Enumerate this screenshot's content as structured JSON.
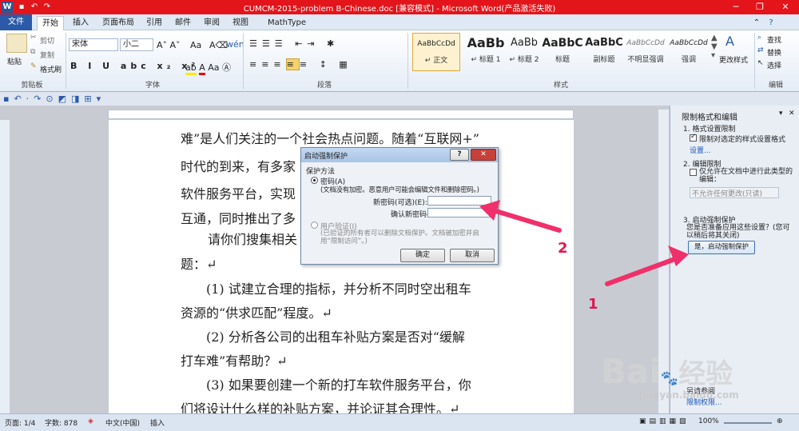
{
  "titlebar": {
    "title": "CUMCM-2015-problem B-Chinese.doc [兼容模式] - Microsoft Word(产品激活失败)",
    "app_icon": "W"
  },
  "tabs": [
    "文件",
    "开始",
    "插入",
    "页面布局",
    "引用",
    "邮件",
    "审阅",
    "视图",
    "MathType"
  ],
  "ribbon": {
    "clipboard": {
      "paste": "粘贴",
      "cut": "剪切",
      "copy": "复制",
      "format_painter": "格式刷",
      "label": "剪贴板"
    },
    "font": {
      "name": "宋体",
      "size": "小二",
      "label": "字体"
    },
    "paragraph": {
      "label": "段落"
    },
    "styles": {
      "items": [
        {
          "preview": "AaBbCcDd",
          "name": "↵ 正文"
        },
        {
          "preview": "AaBb",
          "name": "↵ 标题 1"
        },
        {
          "preview": "AaBb",
          "name": "↵ 标题 2"
        },
        {
          "preview": "AaBbC",
          "name": "标题"
        },
        {
          "preview": "AaBbC",
          "name": "副标题"
        },
        {
          "preview": "AaBbCcDd",
          "name": "不明显强调"
        },
        {
          "preview": "AaBbCcDd",
          "name": "强调"
        }
      ],
      "change": "更改样式",
      "label": "样式"
    },
    "editing": {
      "find": "查找",
      "replace": "替换",
      "select": "选择",
      "label": "编辑"
    }
  },
  "document": {
    "lines": [
      "难”是人们关注的一个社会热点问题。随着“互联网+”",
      "时代的到来，有多家",
      "软件服务平台，实现",
      "互通，同时推出了多",
      "请你们搜集相关",
      "题：↵",
      "(1) 试建立合理的指标，并分析不同时空出租车",
      "资源的“供求匹配”程度。↵",
      "(2) 分析各公司的出租车补贴方案是否对“缓解",
      "打车难”有帮助？↵",
      "(3) 如果要创建一个新的打车软件服务平台，你",
      "们将设计什么样的补贴方案，并论证其合理性。↵"
    ]
  },
  "dialog": {
    "title": "启动强制保护",
    "help": "?",
    "close": "✕",
    "section": "保护方法",
    "password_option": "密码(A)",
    "password_note": "(文档没有加密。恶意用户可能会编辑文件和删除密码。)",
    "new_password_label": "新密码(可选)(E):",
    "confirm_password_label": "确认新密码(P):",
    "user_auth_option": "用户验证(I)",
    "user_auth_note": "(已验证的所有者可以删除文档保护。文档被加密并启用“限制访问”。)",
    "ok": "确定",
    "cancel": "取消"
  },
  "pane": {
    "title": "限制格式和编辑",
    "s1": "1. 格式设置限制",
    "s1_check": "限制对选定的样式设置格式",
    "s1_link": "设置...",
    "s2": "2. 编辑限制",
    "s2_check": "仅允许在文档中进行此类型的编辑：",
    "s2_select": "不允许任何更改(只读)",
    "s3": "3. 启动强制保护",
    "s3_text": "您是否准备应用这些设置？(您可以稍后将其关闭)",
    "s3_button": "是，启动强制保护",
    "see_also": "另请参阅",
    "restrict_link": "限制权限..."
  },
  "annotations": {
    "n1": "1",
    "n2": "2"
  },
  "status": {
    "page": "页面: 1/4",
    "words": "字数: 878",
    "lang": "中文(中国)",
    "mode": "插入",
    "zoom": "100%"
  },
  "watermark": {
    "brand": "Bai",
    "brand2": "经验",
    "site": "jingyan.baidu.com"
  },
  "colors": {
    "titlebar": "#e4141b",
    "arrow": "#f0306a",
    "file_tab": "#2a5aa8"
  }
}
